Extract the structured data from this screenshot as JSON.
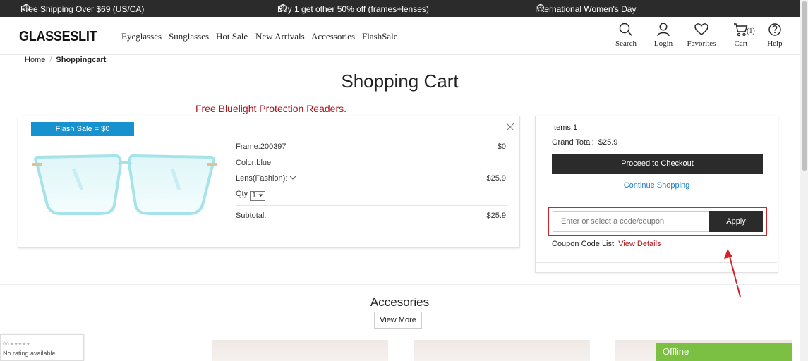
{
  "promo_bar": {
    "items": [
      "Free Shipping Over $69 (US/CA)",
      "Buy 1 get other 50% off (frames+lenses)",
      "International Women's Day"
    ],
    "info_glyph": "?"
  },
  "header": {
    "logo": "GLASSESLIT",
    "nav": [
      "Eyeglasses",
      "Sunglasses",
      "Hot Sale",
      "New Arrivals",
      "Accessories",
      "FlashSale"
    ],
    "tools": {
      "search": "Search",
      "login": "Login",
      "favorites": "Favorites",
      "cart": "Cart",
      "cart_count": "(1)",
      "help": "Help"
    }
  },
  "breadcrumb": {
    "home": "Home",
    "separator": "/",
    "current": "Shoppingcart"
  },
  "page_title": "Shopping Cart",
  "promo_message": "Free Bluelight Protection Readers.",
  "cart_item": {
    "badge": "Flash Sale = $0",
    "frame_label": "Frame:200397",
    "frame_price": "$0",
    "color_label": "Color:blue",
    "lens_label": "Lens(Fashion):",
    "lens_price": "$25.9",
    "qty_label": "Qty",
    "qty_value": "1",
    "subtotal_label": "Subtotal:",
    "subtotal_value": "$25.9"
  },
  "summary": {
    "items": "Items:1",
    "grand_total_label": "Grand Total:",
    "grand_total_value": "$25.9",
    "checkout_button": "Proceed to Checkout",
    "continue_link": "Continue Shopping",
    "coupon_placeholder": "Enter or select a code/coupon",
    "apply_button": "Apply",
    "coupon_list_label": "Coupon Code List:",
    "view_details": "View Details"
  },
  "accessories": {
    "title": "Accesories",
    "view_more": "View More"
  },
  "rating_widget": {
    "stars": "0.0 ★★★★★",
    "text": "No rating available"
  },
  "chat_widget": {
    "status": "Offline"
  },
  "colors": {
    "accent_blue": "#1792cf",
    "promo_red": "#b0121b",
    "dark": "#2b2b2b",
    "chat_green": "#7bc043",
    "highlight_red": "#d1232a"
  }
}
